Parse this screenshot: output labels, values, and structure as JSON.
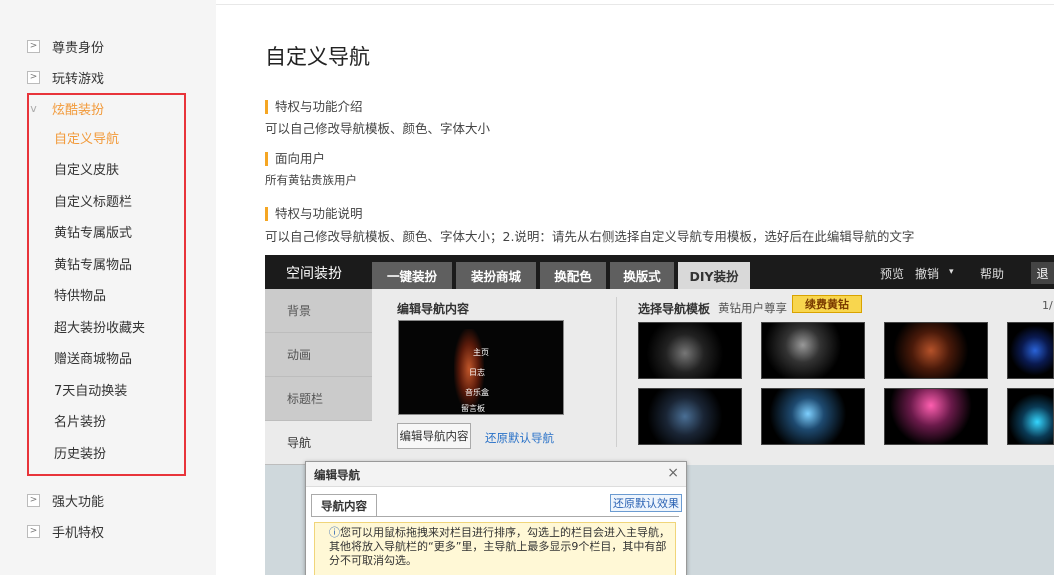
{
  "sidebar": {
    "groups_top": [
      {
        "label": "尊贵身份"
      },
      {
        "label": "玩转游戏"
      },
      {
        "label": "炫酷装扮"
      }
    ],
    "sub_items": [
      {
        "label": "自定义导航"
      },
      {
        "label": "自定义皮肤"
      },
      {
        "label": "自定义标题栏"
      },
      {
        "label": "黄钻专属版式"
      },
      {
        "label": "黄钻专属物品"
      },
      {
        "label": "特供物品"
      },
      {
        "label": "超大装扮收藏夹"
      },
      {
        "label": "赠送商城物品"
      },
      {
        "label": "7天自动换装"
      },
      {
        "label": "名片装扮"
      },
      {
        "label": "历史装扮"
      }
    ],
    "groups_bottom": [
      {
        "label": "强大功能"
      },
      {
        "label": "手机特权"
      }
    ],
    "collapsed_icon": ">",
    "expanded_icon": "v"
  },
  "main": {
    "title": "自定义导航",
    "sections": [
      {
        "heading": "特权与功能介绍",
        "body": "可以自己修改导航模板、颜色、字体大小"
      },
      {
        "heading": "面向用户",
        "body": "所有黄钻贵族用户"
      },
      {
        "heading": "特权与功能说明",
        "body": "可以自己修改导航模板、颜色、字体大小；2.说明：请先从右侧选择自定义导航专用模板，选好后在此编辑导航的文字"
      }
    ]
  },
  "screenshot": {
    "brand": "空间装扮",
    "tabs": [
      {
        "label": "一键装扮"
      },
      {
        "label": "装扮商城"
      },
      {
        "label": "换配色"
      },
      {
        "label": "换版式"
      },
      {
        "label": "DIY装扮"
      }
    ],
    "top_right": {
      "preview": "预览",
      "undo": "撤销",
      "undo_arrow": "▾",
      "help": "帮助",
      "exit": "退"
    },
    "side_items": [
      {
        "label": "背景"
      },
      {
        "label": "动画"
      },
      {
        "label": "标题栏"
      },
      {
        "label": "导航"
      }
    ],
    "edit_label": "编辑导航内容",
    "preview_items": [
      "主页",
      "日志",
      "音乐盒",
      "留言板"
    ],
    "edit_button": "编辑导航内容",
    "restore_link": "还原默认导航",
    "template_label": "选择导航模板",
    "vip_note": "黄钻用户尊享",
    "vip_badge": "续费黄钻",
    "page_num": "1/",
    "dialog": {
      "title": "编辑导航",
      "close": "×",
      "tab": "导航内容",
      "restore": "还原默认效果",
      "notice_icon": "ⓘ",
      "notice_line1": "您可以用鼠标拖拽来对栏目进行排序，勾选上的栏目会进入主导航，",
      "notice_line2": "其他将放入导航栏的“更多”里，主导航上最多显示9个栏目，其中有部",
      "notice_line3": "分不可取消勾选。"
    }
  },
  "colors": {
    "accent": "#f29a3a",
    "highlight_border": "#e8343a",
    "section_marker": "#f5a623",
    "link": "#2a72c8"
  }
}
